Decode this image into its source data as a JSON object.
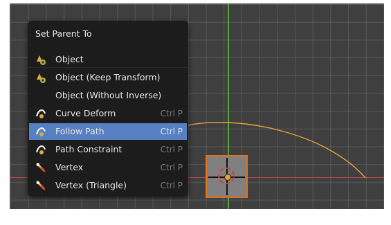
{
  "colors": {
    "grid_bg": "#3f3f3f",
    "x_axis": "#b64a4e",
    "y_axis": "#5aa23a",
    "curve": "#e9a53c",
    "object_outline": "#e0721c",
    "menu_bg": "#1c1c1c",
    "menu_highlight": "#5680c2"
  },
  "menu": {
    "title": "Set Parent To",
    "items": [
      {
        "label": "Object",
        "shortcut": "",
        "icon": "object-icon",
        "highlighted": false
      },
      {
        "label": "Object (Keep Transform)",
        "shortcut": "",
        "icon": "object-icon",
        "highlighted": false
      },
      {
        "label": "Object (Without Inverse)",
        "shortcut": "",
        "icon": "",
        "highlighted": false
      },
      {
        "label": "Curve Deform",
        "shortcut": "Ctrl P",
        "icon": "curve-icon",
        "highlighted": false
      },
      {
        "label": "Follow Path",
        "shortcut": "Ctrl P",
        "icon": "curve-icon",
        "highlighted": true
      },
      {
        "label": "Path Constraint",
        "shortcut": "Ctrl P",
        "icon": "curve-icon",
        "highlighted": false
      },
      {
        "label": "Vertex",
        "shortcut": "Ctrl P",
        "icon": "vertex-icon",
        "highlighted": false
      },
      {
        "label": "Vertex (Triangle)",
        "shortcut": "Ctrl P",
        "icon": "vertex-icon",
        "highlighted": false
      }
    ]
  }
}
